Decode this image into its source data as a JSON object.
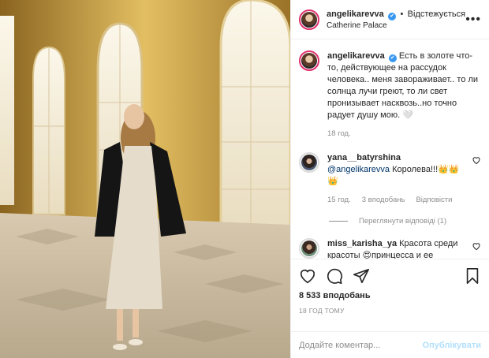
{
  "header": {
    "username": "angelikarevva",
    "verified_badge": "✔",
    "separator": "•",
    "follow_label": "Відстежується",
    "location": "Catherine Palace",
    "more_icon": "more-dots-icon"
  },
  "caption": {
    "username": "angelikarevva",
    "verified_badge": "✔",
    "text": "Есть в золоте что-то, действующее на рассудок человека.. меня завораживает.. то ли солнца лучи греют, то ли свет пронизывает насквозь..но точно радует душу мою. 🤍",
    "time": "18 год."
  },
  "comments": [
    {
      "username": "yana__batyrshina",
      "mention": "@angelikarevva",
      "text": "Королева!!!👑👑👑",
      "time": "15 год.",
      "likes": "3 вподобань",
      "reply_label": "Відповісти",
      "view_replies": "Переглянути відповіді (1)"
    },
    {
      "username": "miss_karisha_ya",
      "text": "Красота среди красоты 😍принцесса и ее дворец)))"
    }
  ],
  "actions": {
    "likes": "8 533 вподобань",
    "time": "18 ГОД ТОМУ"
  },
  "add_comment": {
    "placeholder": "Додайте коментар...",
    "publish_label": "Опублікувати"
  },
  "colors": {
    "verified": "#3897f0",
    "mention": "#00376b",
    "publish": "#b2dffc",
    "gold": "#c9a550"
  }
}
